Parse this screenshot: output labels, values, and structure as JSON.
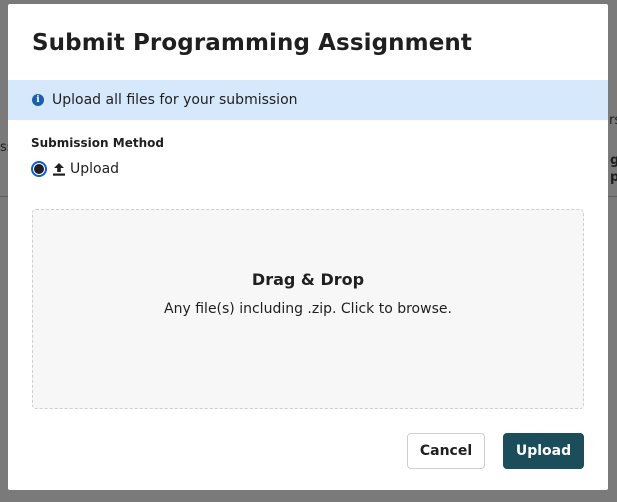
{
  "modal": {
    "title": "Submit Programming Assignment",
    "info_banner": {
      "icon": "info-icon",
      "text": "Upload all files for your submission"
    },
    "submission_method": {
      "label": "Submission Method",
      "option": {
        "icon": "upload-icon",
        "label": "Upload",
        "selected": true
      }
    },
    "dropzone": {
      "title": "Drag & Drop",
      "subtitle": "Any file(s) including .zip. Click to browse."
    },
    "buttons": {
      "cancel": "Cancel",
      "upload": "Upload"
    }
  },
  "background_fragments": {
    "right_top": "rs",
    "left_mid": "ss",
    "right_mid_1": "g",
    "right_mid_2": "p"
  },
  "colors": {
    "overlay": "#7a7a7a",
    "banner_bg": "#d6e8fb",
    "info_icon": "#1d5fa8",
    "radio_ring": "#0b5cd5",
    "primary_button": "#1b4d5a",
    "dropzone_bg": "#f7f7f7"
  }
}
